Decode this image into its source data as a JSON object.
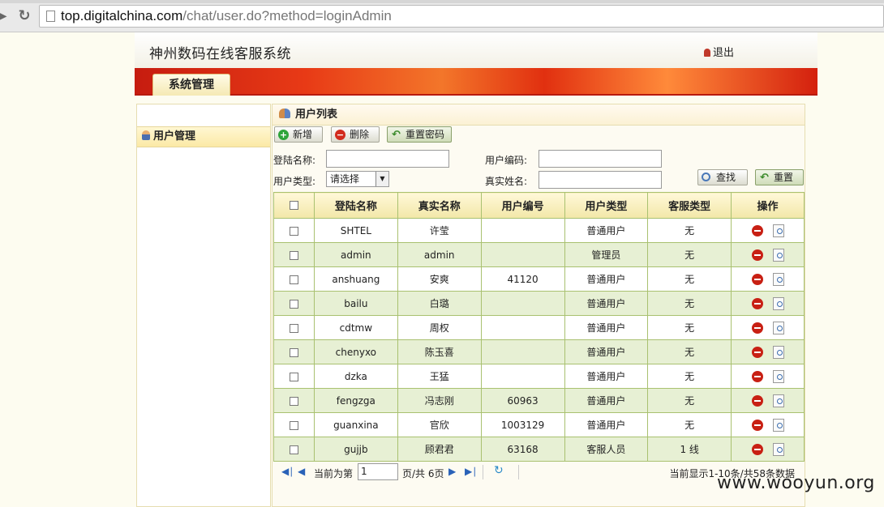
{
  "browser": {
    "url_host": "top.digitalchina.com",
    "url_path": "/chat/user.do?method=loginAdmin"
  },
  "header": {
    "app_title": "神州数码在线客服系统",
    "logout_label": "退出"
  },
  "nav": {
    "active_tab": "系统管理"
  },
  "sidebar": {
    "items": [
      {
        "label": "用户管理"
      }
    ]
  },
  "main": {
    "title": "用户列表",
    "toolbar": {
      "add": "新增",
      "delete": "删除",
      "reset_password": "重置密码"
    },
    "filters": {
      "login_name_label": "登陆名称:",
      "user_code_label": "用户编码:",
      "user_type_label": "用户类型:",
      "user_type_value": "请选择",
      "real_name_label": "真实姓名:",
      "search_label": "查找",
      "reset_label": "重置"
    },
    "table": {
      "headers": [
        "登陆名称",
        "真实名称",
        "用户编号",
        "用户类型",
        "客服类型",
        "操作"
      ],
      "rows": [
        [
          "SHTEL",
          "许莹",
          "",
          "普通用户",
          "无"
        ],
        [
          "admin",
          "admin",
          "",
          "管理员",
          "无"
        ],
        [
          "anshuang",
          "安爽",
          "41120",
          "普通用户",
          "无"
        ],
        [
          "bailu",
          "白璐",
          "",
          "普通用户",
          "无"
        ],
        [
          "cdtmw",
          "周权",
          "",
          "普通用户",
          "无"
        ],
        [
          "chenyxo",
          "陈玉喜",
          "",
          "普通用户",
          "无"
        ],
        [
          "dzka",
          "王猛",
          "",
          "普通用户",
          "无"
        ],
        [
          "fengzga",
          "冯志刚",
          "60963",
          "普通用户",
          "无"
        ],
        [
          "guanxina",
          "官欣",
          "1003129",
          "普通用户",
          "无"
        ],
        [
          "gujjb",
          "顾君君",
          "63168",
          "客服人员",
          "1 线"
        ]
      ]
    },
    "pager": {
      "current_label": "当前为第",
      "page_value": "1",
      "total_label": "页/共 6页",
      "record_info": "当前显示1-10条/共58条数据"
    }
  },
  "watermark": "www.wooyun.org"
}
